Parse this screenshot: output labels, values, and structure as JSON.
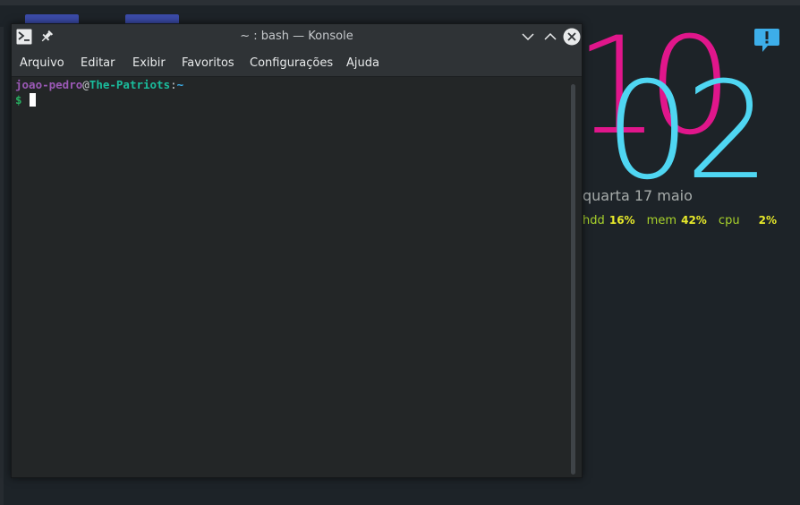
{
  "window": {
    "title": "~ : bash — Konsole"
  },
  "menu": {
    "items": [
      "Arquivo",
      "Editar",
      "Exibir",
      "Favoritos",
      "Configurações",
      "Ajuda"
    ]
  },
  "terminal": {
    "user": "joao-pedro",
    "at": "@",
    "host": "The-Patriots",
    "separator": ":",
    "path": "~",
    "prompt": "$"
  },
  "clock": {
    "hour": "10",
    "minutes": "02",
    "date": "quarta  17 maio"
  },
  "stats": {
    "hdd_label": "hdd",
    "hdd_value": "16%",
    "mem_label": "mem",
    "mem_value": "42%",
    "cpu_label": "cpu",
    "cpu_value": "2%"
  },
  "icons": {
    "terminal": "terminal-icon",
    "pin": "pin-icon",
    "minimize": "chevron-down-icon",
    "maximize": "chevron-up-icon",
    "close": "close-icon",
    "notify": "notification-icon"
  },
  "colors": {
    "hour": "#e0168b",
    "minutes": "#4fd6f2",
    "stat_label": "#a8d22b",
    "stat_value": "#e7e92a",
    "user": "#9b59b6",
    "host": "#1abc9c",
    "path": "#3daee9"
  }
}
